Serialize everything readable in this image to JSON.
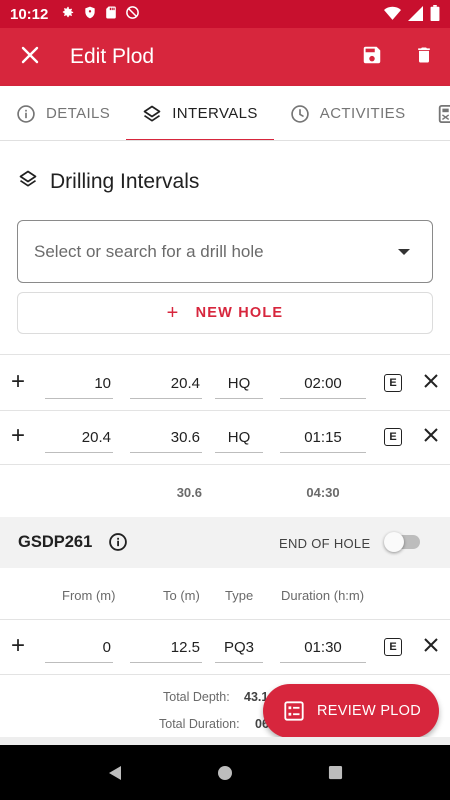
{
  "status_bar": {
    "time": "10:12"
  },
  "app_bar": {
    "title": "Edit Plod"
  },
  "tabs": [
    {
      "label": "DETAILS",
      "icon": "info-icon"
    },
    {
      "label": "INTERVALS",
      "icon": "layers-icon"
    },
    {
      "label": "ACTIVITIES",
      "icon": "clock-icon"
    },
    {
      "label": "",
      "icon": "fuel-icon"
    }
  ],
  "drilling": {
    "title": "Drilling Intervals",
    "select_placeholder": "Select or search for a drill hole",
    "new_hole_label": "NEW HOLE"
  },
  "first_hole": {
    "rows": [
      {
        "from": "10",
        "to": "20.4",
        "type": "HQ",
        "duration": "02:00",
        "edit_label": "E"
      },
      {
        "from": "20.4",
        "to": "30.6",
        "type": "HQ",
        "duration": "01:15",
        "edit_label": "E"
      }
    ],
    "total_to": "30.6",
    "total_duration": "04:30"
  },
  "second_hole": {
    "name": "GSDP261",
    "end_of_hole_label": "END OF HOLE",
    "end_of_hole": false,
    "headers": {
      "from": "From (m)",
      "to": "To (m)",
      "type": "Type",
      "duration": "Duration (h:m)"
    },
    "rows": [
      {
        "from": "0",
        "to": "12.5",
        "type": "PQ3",
        "duration": "01:30",
        "edit_label": "E"
      }
    ],
    "total_depth_label": "Total Depth:",
    "total_depth_value": "43.1",
    "total_duration_label": "Total Duration:",
    "total_duration_value": "06:00"
  },
  "fab": {
    "label": "REVIEW PLOD"
  },
  "colors": {
    "primary": "#d7263d",
    "status_bar": "#c8102e"
  }
}
